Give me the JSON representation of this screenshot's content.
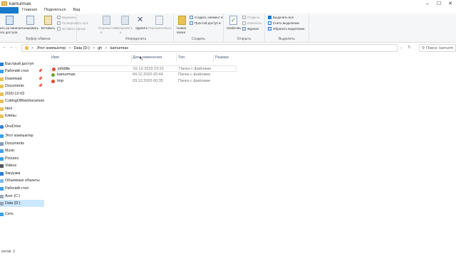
{
  "window": {
    "title": "kamurmax"
  },
  "tabs": [
    "Главная",
    "Поделиться",
    "Вид"
  ],
  "ribbon": {
    "clipboard": {
      "pin_label_line1": "ить на панели",
      "pin_label_line2": "ого доступа",
      "copy": "Копировать",
      "paste": "Вставить",
      "cut": "Вырезать",
      "copy_path": "Скопировать путь",
      "paste_shortcut": "Вставить ярлык",
      "group": "Буфер обмена"
    },
    "organize": {
      "move": "Переместить",
      "move2": "в",
      "copyto": "Копировать",
      "copyto2": "в",
      "delete": "Удалить",
      "rename": "Переименовать",
      "group": "Упорядочить"
    },
    "create": {
      "new_folder_1": "Новая",
      "new_folder_2": "папка",
      "new_item": "Создать элемент",
      "easy_access": "Простой доступ",
      "group": "Создать"
    },
    "open": {
      "properties": "Свойства",
      "open": "Открыть",
      "edit": "Изменить",
      "history": "Журнал",
      "group": "Открыть"
    },
    "select": {
      "select_all": "Выделить все",
      "select_none": "Снять выделение",
      "invert": "Обратить выделение",
      "group": "Выделить"
    }
  },
  "address": {
    "crumbs": [
      "Этот компьютер",
      "Data (D:)",
      "gh",
      "kamurmax"
    ],
    "separator": ">",
    "search_placeholder": "Поиск: kamurm"
  },
  "sidebar": {
    "items": [
      {
        "label": "Быстрый доступ",
        "pinned": false
      },
      {
        "label": "Рабочий стол",
        "pinned": true
      },
      {
        "label": "Download",
        "pinned": true
      },
      {
        "label": "Documents",
        "pinned": true
      },
      {
        "label": "2020-12-03",
        "pinned": false
      },
      {
        "label": "CuttingOfReinforcement",
        "pinned": false
      },
      {
        "label": "html",
        "pinned": false
      },
      {
        "label": "Клипы",
        "pinned": false
      },
      {
        "label": "OneDrive",
        "pinned": false
      },
      {
        "label": "Этот компьютер",
        "pinned": false
      },
      {
        "label": "Documents",
        "pinned": false
      },
      {
        "label": "Music",
        "pinned": false
      },
      {
        "label": "Pictures",
        "pinned": false
      },
      {
        "label": "Videos",
        "pinned": false
      },
      {
        "label": "Загрузки",
        "pinned": false
      },
      {
        "label": "Объемные объекты",
        "pinned": false
      },
      {
        "label": "Рабочий стол",
        "pinned": false
      },
      {
        "label": "Acer (C:)",
        "pinned": false
      },
      {
        "label": "Data (D:)",
        "pinned": false
      },
      {
        "label": "Сеть",
        "pinned": false
      }
    ],
    "pin_glyph": "📌"
  },
  "columns": {
    "name": "Имя",
    "date": "Дата изменения",
    "type": "Тип",
    "size": "Размер"
  },
  "files": [
    {
      "name": "jsfiddle",
      "date": "02.12.2020 23:22",
      "type": "Папка с файлами",
      "icon_color": "#e04a2a"
    },
    {
      "name": "kamurmax",
      "date": "04.12.2020 20:44",
      "type": "Папка с файлами",
      "icon_color": "#6aa334"
    },
    {
      "name": "tmp",
      "date": "03.12.2020 00:35",
      "type": "Папка с файлами",
      "icon_color": "#e04a2a"
    }
  ],
  "status": {
    "count_text": "ентов: 3"
  },
  "colors": {
    "accent": "#1979ca",
    "selected": "#cce8ff",
    "folder": "#e8c25a"
  }
}
